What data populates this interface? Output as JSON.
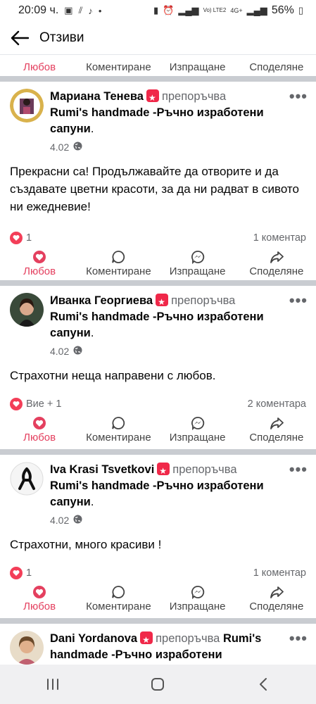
{
  "status_bar": {
    "time": "20:09 ч.",
    "network": "Vo) LTE2",
    "network_gen": "4G+",
    "battery": "56%"
  },
  "appbar": {
    "title": "Отзиви"
  },
  "actions": {
    "like": "Любов",
    "comment": "Коментиране",
    "send": "Изпращане",
    "share": "Споделяне"
  },
  "reviews": [
    {
      "author": "Мариана Тенева",
      "verb": "препоръчва",
      "page": "Rumi's handmade -Ръчно изработени сапуни",
      "date": "4.02",
      "text": "Прекрасни са! Продължавайте да отворите и да създавате цветни красоти, за да ни радват в сивото ни ежедневие!",
      "reactions": "1",
      "comments": "1 коментар"
    },
    {
      "author": "Иванка Георгиева",
      "verb": "препоръчва",
      "page": "Rumi's handmade -Ръчно изработени сапуни",
      "date": "4.02",
      "text": "Страхотни неща направени с любов.",
      "reactions": "Вие + 1",
      "comments": "2 коментара"
    },
    {
      "author": "Iva Krasi Tsvetkovi",
      "verb": "препоръчва",
      "page": "Rumi's handmade -Ръчно изработени сапуни",
      "date": "4.02",
      "text": "Страхотни, много красиви !",
      "reactions": "1",
      "comments": "1 коментар"
    },
    {
      "author": "Dani Yordanova",
      "verb": "препоръчва",
      "page": "Rumi's handmade -Ръчно изработени"
    }
  ],
  "colors": {
    "love": "#e4405f",
    "divider": "#c9ccd1",
    "muted": "#65676b"
  }
}
